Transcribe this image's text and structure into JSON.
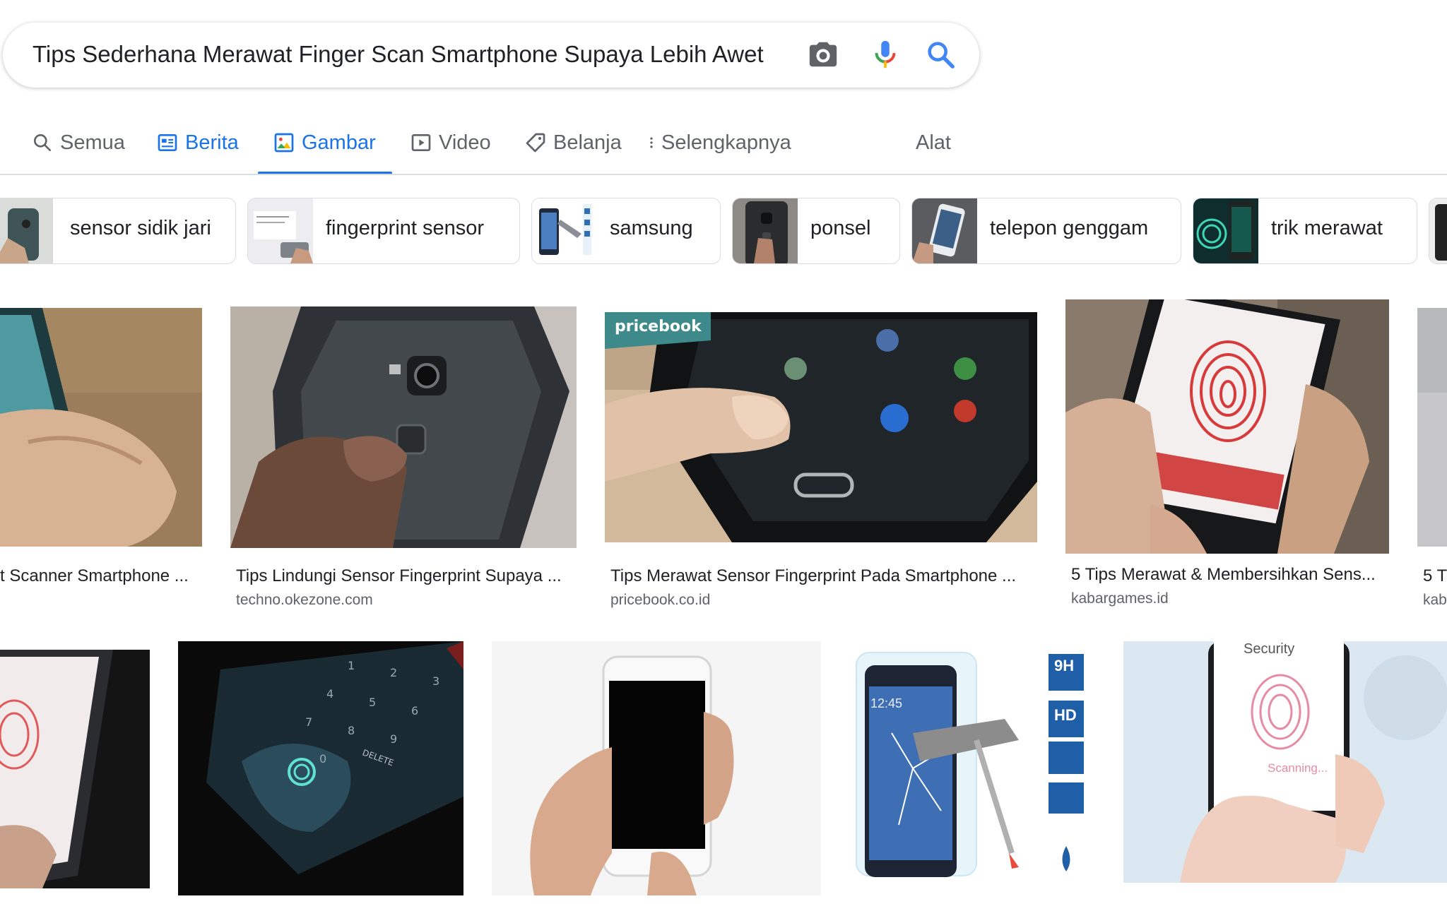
{
  "search": {
    "query": "Tips Sederhana Merawat Finger Scan Smartphone Supaya Lebih Awet"
  },
  "tabs": [
    {
      "label": "Semua",
      "icon": "search-icon"
    },
    {
      "label": "Berita",
      "icon": "news-icon"
    },
    {
      "label": "Gambar",
      "icon": "image-icon",
      "active": true
    },
    {
      "label": "Video",
      "icon": "play-icon"
    },
    {
      "label": "Belanja",
      "icon": "tag-icon"
    },
    {
      "label": "Selengkapnya",
      "icon": "more-vertical-icon"
    }
  ],
  "tools_label": "Alat",
  "chips": [
    {
      "label": "sensor sidik jari"
    },
    {
      "label": "fingerprint sensor"
    },
    {
      "label": "samsung"
    },
    {
      "label": "ponsel"
    },
    {
      "label": "telepon genggam"
    },
    {
      "label": "trik merawat"
    }
  ],
  "results_row1": [
    {
      "title": "t Scanner Smartphone ...",
      "site": ""
    },
    {
      "title": "Tips Lindungi Sensor Fingerprint Supaya ...",
      "site": "techno.okezone.com"
    },
    {
      "title": "Tips Merawat Sensor Fingerprint Pada Smartphone ...",
      "site": "pricebook.co.id",
      "watermark": "pricebook"
    },
    {
      "title": "5 Tips Merawat & Membersihkan Sens...",
      "site": "kabargames.id"
    },
    {
      "title": "5 T",
      "site": "kab"
    }
  ],
  "results_row2_overlay": {
    "keypad_delete": "DELETE",
    "badges": [
      "9H",
      "HD"
    ],
    "phone_time": "12:45",
    "scan_text": "Scanning...",
    "security_text": "Security"
  },
  "colors": {
    "accent": "#1a73e8",
    "text": "#202124",
    "secondary": "#5f6368",
    "border": "#dadce0"
  }
}
